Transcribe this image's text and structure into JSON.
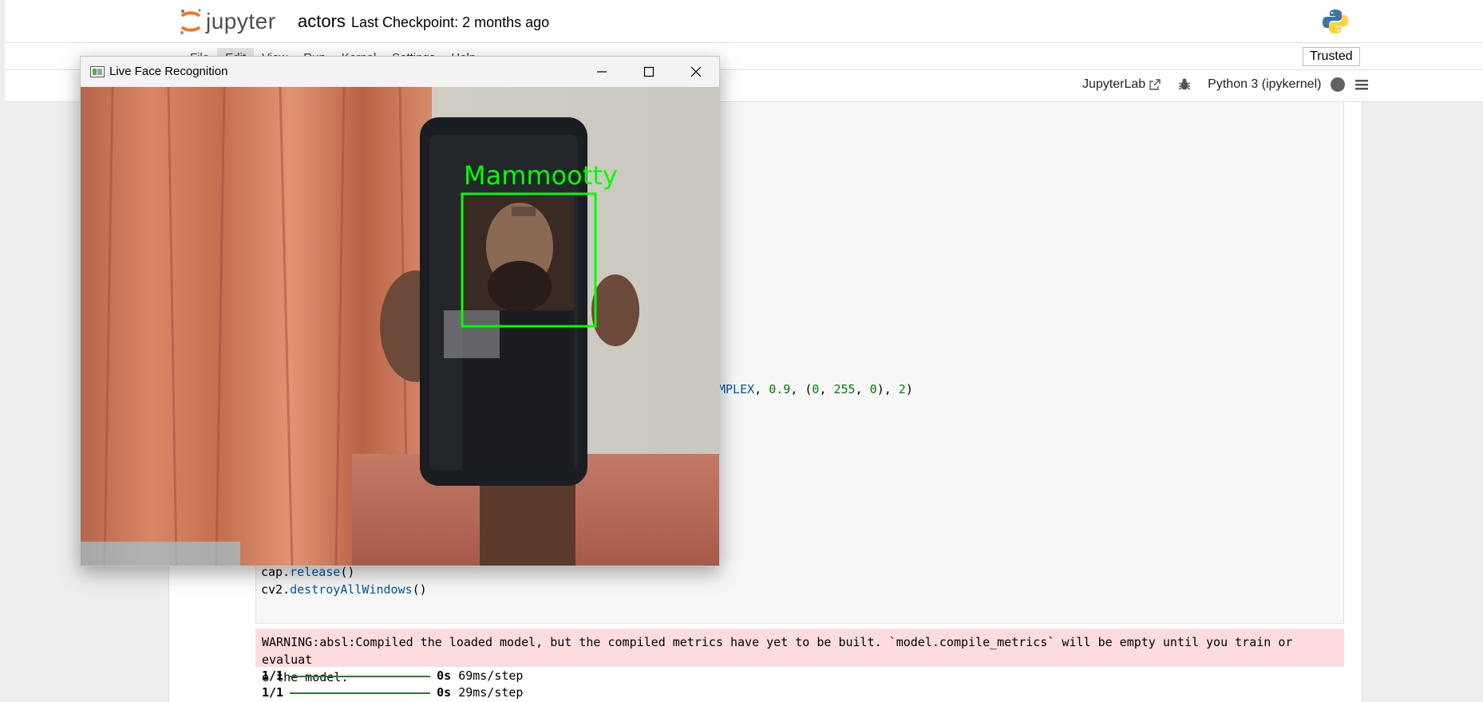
{
  "jupyter": {
    "logo_text": "jupyter",
    "notebook_name": "actors",
    "checkpoint": "Last Checkpoint: 2 months ago",
    "menu": [
      "File",
      "Edit",
      "View",
      "Run",
      "Kernel",
      "Settings",
      "Help"
    ],
    "trusted_label": "Trusted",
    "toolbar": {
      "jupyterlab_label": "JupyterLab",
      "kernel_label": "Python 3 (ipykernel)"
    }
  },
  "code": {
    "visible_tail": "MPLEX, 0.9, (0, 255, 0), 2)",
    "line_release_obj": "cap.",
    "line_release_fn": "release",
    "line_release_end": "()",
    "line_destroy_obj": "cv2.",
    "line_destroy_fn": "destroyAllWindows",
    "line_destroy_end": "()"
  },
  "output": {
    "warning_line1": "WARNING:absl:Compiled the loaded model, but the compiled metrics have yet to be built. `model.compile_metrics` will be empty until you train or evaluat",
    "warning_line2": "e the model.",
    "steps": [
      {
        "count": "1/1",
        "time": "0s",
        "rate": "69ms/step"
      },
      {
        "count": "1/1",
        "time": "0s",
        "rate": "29ms/step"
      }
    ]
  },
  "window": {
    "title": "Live Face Recognition",
    "detected_label": "Mammootty"
  },
  "colors": {
    "jupyter_orange": "#f37626",
    "detection_green": "#00ff00",
    "warning_bg": "#fcdcdc"
  },
  "icons": [
    "jupyter-logo-icon",
    "python-logo-icon",
    "external-link-icon",
    "bug-icon",
    "kernel-status-icon",
    "menu-icon",
    "window-app-icon",
    "minimize-icon",
    "maximize-icon",
    "close-icon"
  ]
}
